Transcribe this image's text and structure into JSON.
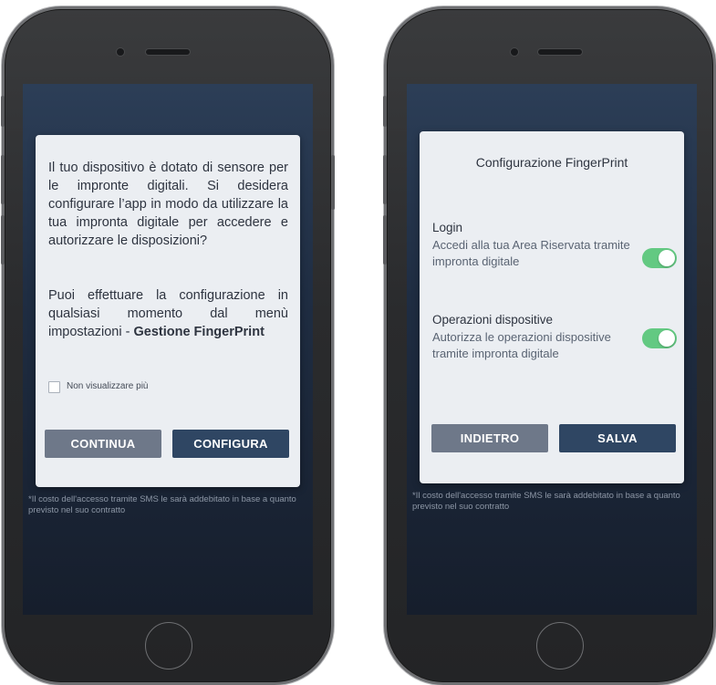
{
  "colors": {
    "screen_bg": "#1f2d42",
    "dialog_bg": "#ebeef2",
    "primary_button": "#2f4663",
    "secondary_button": "#6e7889",
    "toggle_on": "#63c982"
  },
  "left_screen": {
    "dialog": {
      "paragraph1": "Il tuo dispositivo è dotato di sensore per le impronte digitali. Si desidera configurare l’app in modo da utilizzare la tua impronta digitale per accedere e autorizzare le disposizioni?",
      "paragraph2_prefix": "Puoi effettuare la configurazione in qualsiasi momento dal menù impostazioni - ",
      "paragraph2_bold": "Gestione FingerPrint",
      "checkbox_label": "Non visualizzare più",
      "checkbox_checked": false,
      "continue_label": "CONTINUA",
      "configure_label": "CONFIGURA"
    },
    "footnote": "*Il costo dell'accesso tramite SMS le sarà addebitato in base a quanto previsto nel suo contratto"
  },
  "right_screen": {
    "dialog": {
      "title": "Configurazione FingerPrint",
      "settings": [
        {
          "title": "Login",
          "description": "Accedi alla tua Area Riservata tramite impronta digitale",
          "enabled": true
        },
        {
          "title": "Operazioni dispositive",
          "description": "Autorizza le operazioni dispositive tramite impronta digitale",
          "enabled": true
        }
      ],
      "back_label": "INDIETRO",
      "save_label": "SALVA"
    },
    "footnote": "*Il costo dell'accesso tramite SMS le sarà addebitato in base a quanto previsto nel suo contratto"
  }
}
